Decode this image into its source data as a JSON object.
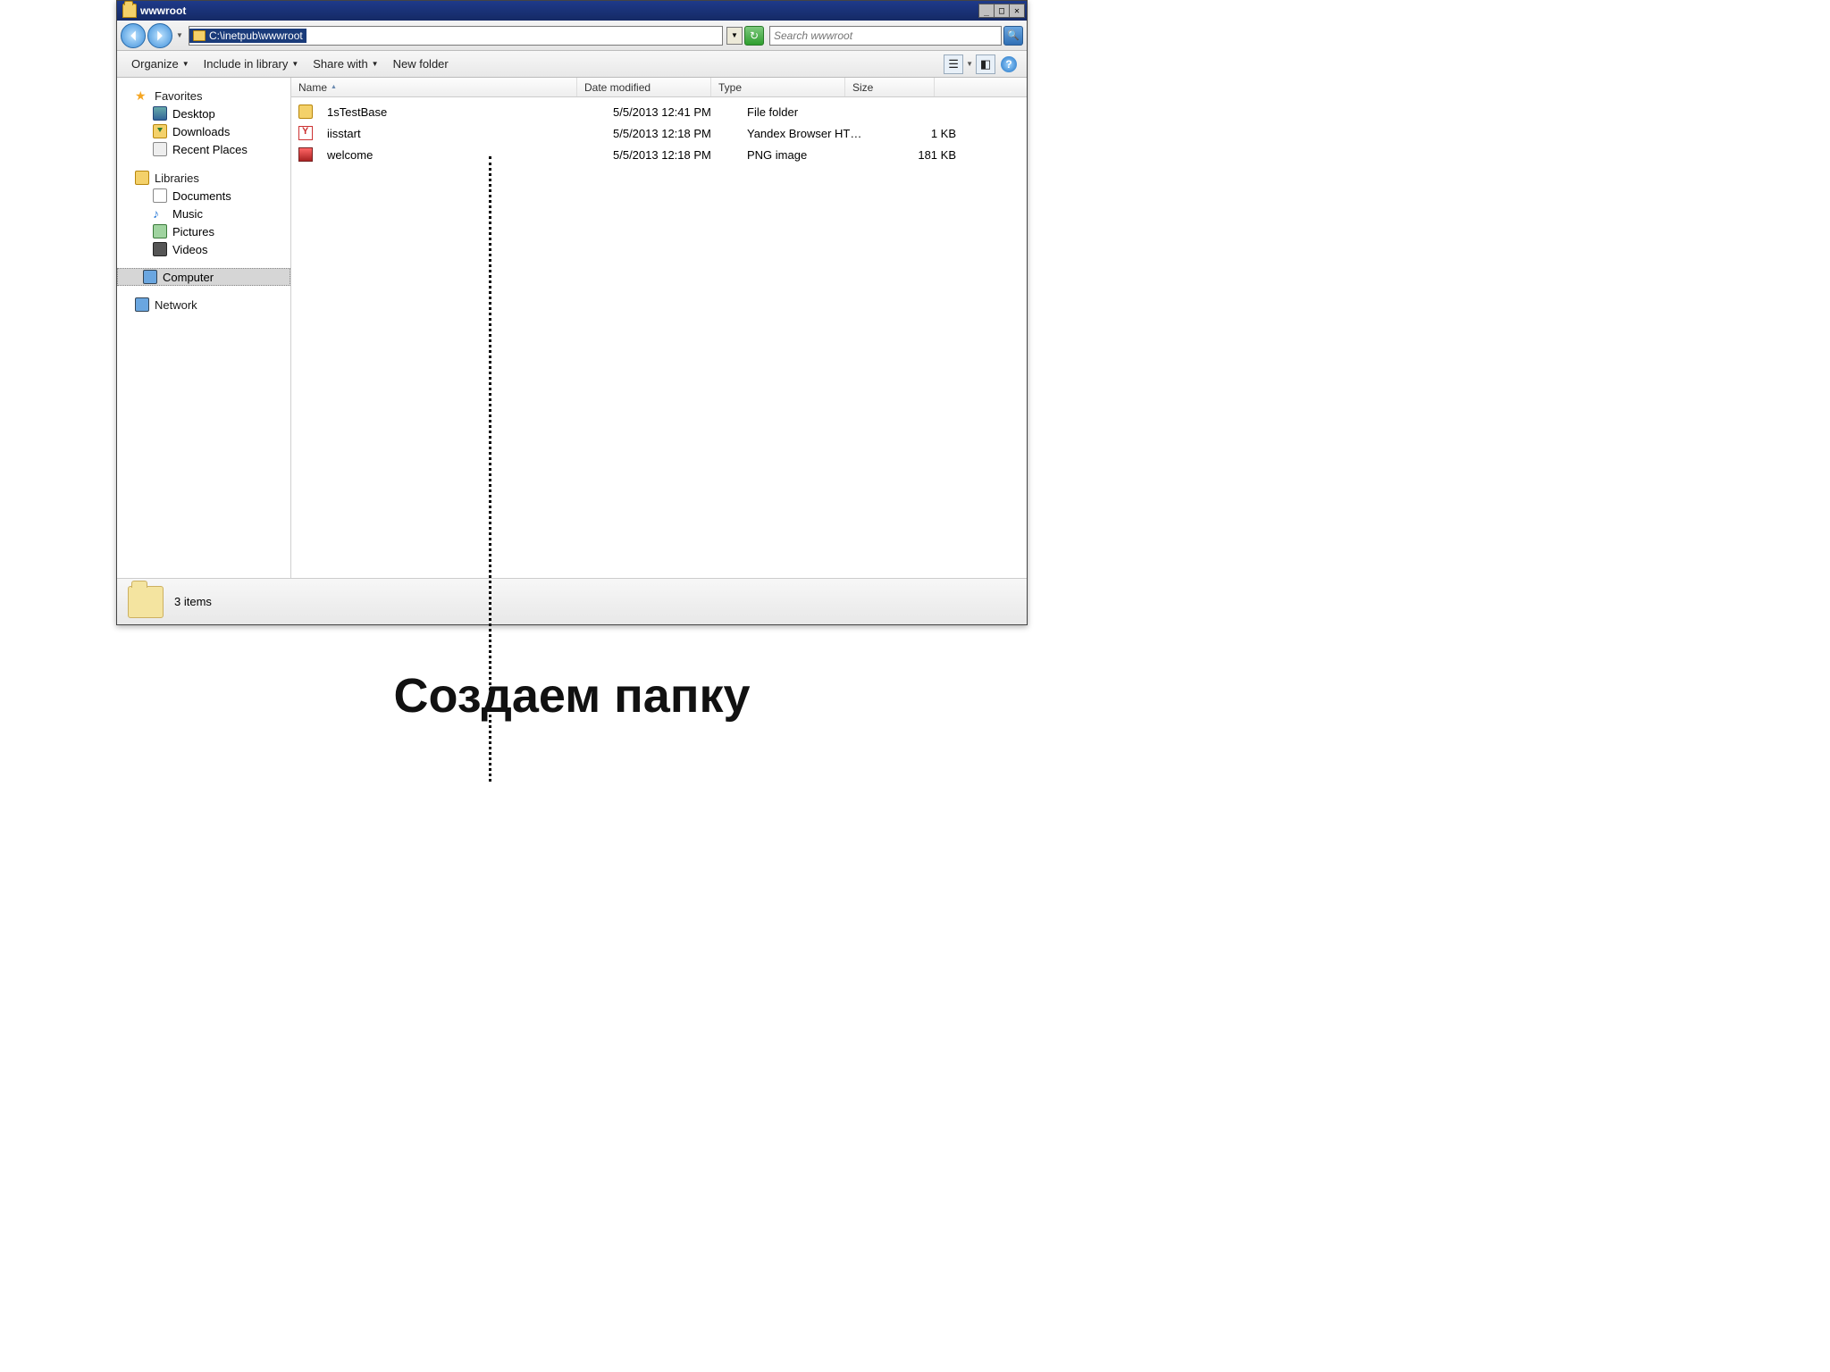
{
  "window": {
    "title": "wwwroot"
  },
  "nav": {
    "path": "C:\\inetpub\\wwwroot"
  },
  "search": {
    "placeholder": "Search wwwroot"
  },
  "toolbar": {
    "organize": "Organize",
    "include": "Include in library",
    "share": "Share with",
    "newfolder": "New folder"
  },
  "sidebar": {
    "favorites": "Favorites",
    "desktop": "Desktop",
    "downloads": "Downloads",
    "recent": "Recent Places",
    "libraries": "Libraries",
    "documents": "Documents",
    "music": "Music",
    "pictures": "Pictures",
    "videos": "Videos",
    "computer": "Computer",
    "network": "Network"
  },
  "columns": {
    "name": "Name",
    "date": "Date modified",
    "type": "Type",
    "size": "Size"
  },
  "files": [
    {
      "name": "1sTestBase",
      "date": "5/5/2013 12:41 PM",
      "type": "File folder",
      "size": ""
    },
    {
      "name": "iisstart",
      "date": "5/5/2013 12:18 PM",
      "type": "Yandex Browser HT…",
      "size": "1 KB"
    },
    {
      "name": "welcome",
      "date": "5/5/2013 12:18 PM",
      "type": "PNG image",
      "size": "181 KB"
    }
  ],
  "status": {
    "items": "3 items"
  },
  "caption": "Создаем папку"
}
